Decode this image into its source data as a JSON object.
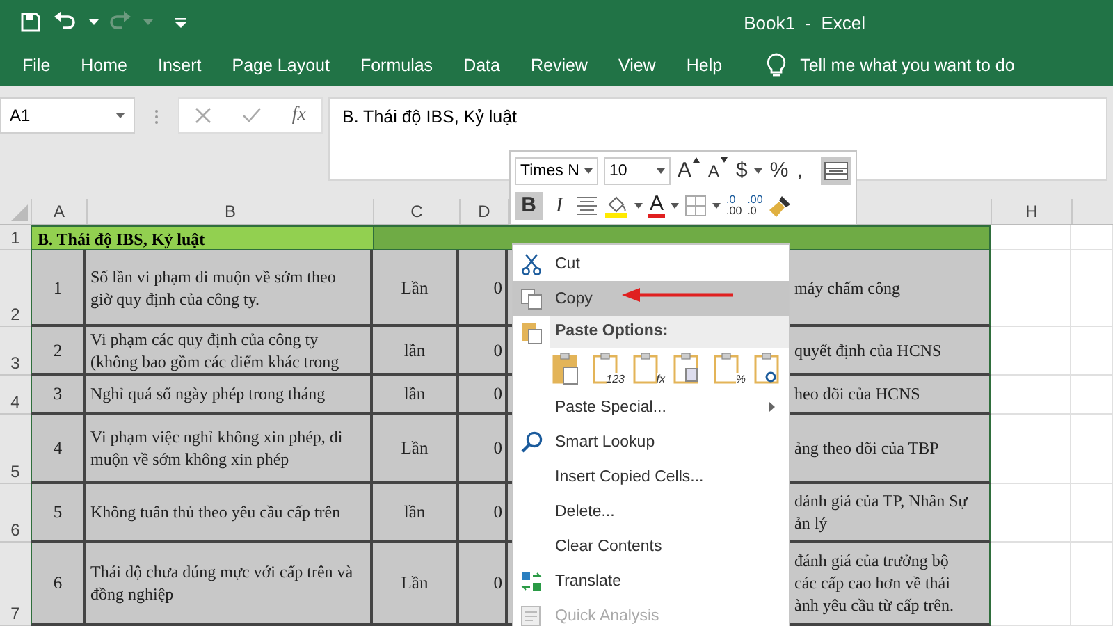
{
  "window": {
    "title": "Book1  -  Excel"
  },
  "ribbon_tabs": [
    {
      "label": "File",
      "selected": false
    },
    {
      "label": "Home",
      "selected": false
    },
    {
      "label": "Insert",
      "selected": false
    },
    {
      "label": "Page Layout",
      "selected": false
    },
    {
      "label": "Formulas",
      "selected": false
    },
    {
      "label": "Data",
      "selected": false
    },
    {
      "label": "Review",
      "selected": false
    },
    {
      "label": "View",
      "selected": false
    },
    {
      "label": "Help",
      "selected": false
    }
  ],
  "tell_me": "Tell me what you want to do",
  "formula_bar": {
    "name_box": "A1",
    "fx": "fx",
    "value": "B. Thái độ IBS, Kỷ luật"
  },
  "columns": [
    "A",
    "B",
    "C",
    "D",
    "",
    "",
    "H",
    ""
  ],
  "row_numbers": [
    "1",
    "2",
    "3",
    "4",
    "5",
    "6",
    "7"
  ],
  "title_row": "B. Thái độ IBS, Kỷ luật",
  "rows": [
    {
      "no": "1",
      "content": "Số lần vi phạm đi muộn về sớm theo\ngiờ quy định của công ty.",
      "unit": "Lần",
      "value": "0",
      "note": "máy chấm công"
    },
    {
      "no": "2",
      "content": "Vi phạm các quy định của công ty\n(không bao gồm các điểm khác trong",
      "unit": "lần",
      "value": "0",
      "note": "quyết định của HCNS"
    },
    {
      "no": "3",
      "content": "Nghỉ quá số ngày phép trong tháng",
      "unit": "lần",
      "value": "0",
      "note": "heo dõi của HCNS"
    },
    {
      "no": "4",
      "content": "Vi phạm việc nghỉ không xin phép, đi\nmuộn về sớm không xin phép",
      "unit": "Lần",
      "value": "0",
      "note": "ảng theo dõi của TBP"
    },
    {
      "no": "5",
      "content": "Không tuân thủ theo yêu cầu cấp trên",
      "unit": "lần",
      "value": "0",
      "note": "đánh giá của TP, Nhân Sự\nản lý"
    },
    {
      "no": "6",
      "content": "Thái độ chưa đúng mực với cấp trên và\nđồng nghiệp",
      "unit": "Lần",
      "value": "0",
      "note": "đánh giá của trưởng bộ\ncác cấp cao hơn về thái\nành yêu cầu từ cấp trên."
    }
  ],
  "mini_toolbar": {
    "font": "Times N",
    "size": "10",
    "row_1": [
      {
        "kind": "grow",
        "text": "A"
      },
      {
        "kind": "shrink",
        "text": "A"
      },
      {
        "kind": "glyph",
        "text": "$"
      },
      {
        "kind": "caret"
      },
      {
        "kind": "glyph",
        "text": "%"
      },
      {
        "kind": "glyph",
        "text": ","
      },
      {
        "kind": "merge"
      }
    ],
    "row_2": [
      {
        "kind": "bold",
        "text": "B",
        "selected": true
      },
      {
        "kind": "italic",
        "text": "I",
        "selected": false
      },
      {
        "kind": "align"
      },
      {
        "kind": "fill"
      },
      {
        "kind": "caret"
      },
      {
        "kind": "fontcolor",
        "text": "A"
      },
      {
        "kind": "caret"
      },
      {
        "kind": "borders"
      },
      {
        "kind": "caret"
      },
      {
        "kind": "decimal",
        "text": ".0",
        "text_2": ".00"
      },
      {
        "kind": "decimal",
        "text": ".00",
        "text_2": ".0"
      },
      {
        "kind": "painter"
      }
    ]
  },
  "context_menu": [
    {
      "kind": "cut",
      "label": "Cut",
      "highlighted": false,
      "disabled": false
    },
    {
      "kind": "copy",
      "label": "Copy",
      "highlighted": true,
      "disabled": false
    },
    {
      "kind": "header",
      "label": "Paste Options:"
    },
    {
      "kind": "paste_icons",
      "icons": [
        {
          "kind": "keep"
        },
        {
          "kind": "values",
          "mark": "123"
        },
        {
          "kind": "formulas",
          "mark": "fx"
        },
        {
          "kind": "transpose"
        },
        {
          "kind": "formatting",
          "mark": "%"
        },
        {
          "kind": "link"
        }
      ]
    },
    {
      "kind": "submenu",
      "label": "Paste Special...",
      "highlighted": false,
      "disabled": false
    },
    {
      "kind": "lookup",
      "label": "Smart Lookup",
      "highlighted": false,
      "disabled": false
    },
    {
      "kind": "item",
      "label": "Insert Copied Cells...",
      "highlighted": false,
      "disabled": false
    },
    {
      "kind": "item",
      "label": "Delete...",
      "highlighted": false,
      "disabled": false
    },
    {
      "kind": "item",
      "label": "Clear Contents",
      "highlighted": false,
      "disabled": false
    },
    {
      "kind": "translate",
      "label": "Translate",
      "highlighted": false,
      "disabled": false
    },
    {
      "kind": "analysis",
      "label": "Quick Analysis",
      "highlighted": false,
      "disabled": true
    }
  ]
}
